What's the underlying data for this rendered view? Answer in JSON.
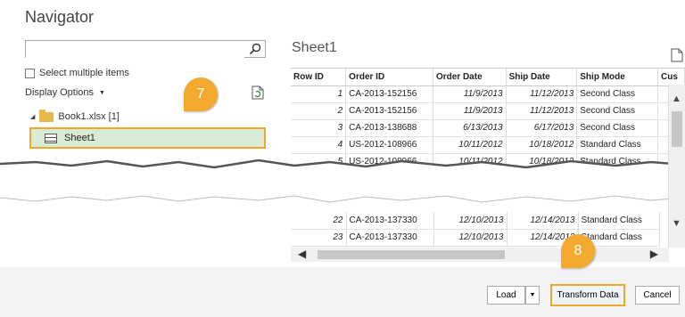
{
  "dialog": {
    "title": "Navigator"
  },
  "left": {
    "search_placeholder": "",
    "select_multiple_label": "Select multiple items",
    "display_options_label": "Display Options",
    "tree": {
      "workbook_label": "Book1.xlsx [1]",
      "sheet_label": "Sheet1"
    }
  },
  "preview": {
    "title": "Sheet1",
    "columns": [
      "Row ID",
      "Order ID",
      "Order Date",
      "Ship Date",
      "Ship Mode",
      "Cus"
    ],
    "rows_top": [
      [
        "1",
        "CA-2013-152156",
        "11/9/2013",
        "11/12/2013",
        "Second Class"
      ],
      [
        "2",
        "CA-2013-152156",
        "11/9/2013",
        "11/12/2013",
        "Second Class"
      ],
      [
        "3",
        "CA-2013-138688",
        "6/13/2013",
        "6/17/2013",
        "Second Class"
      ],
      [
        "4",
        "US-2012-108966",
        "10/11/2012",
        "10/18/2012",
        "Standard Class"
      ],
      [
        "5",
        "US-2012-108966",
        "10/11/2012",
        "10/18/2012",
        "Standard Class"
      ]
    ],
    "rows_bottom": [
      [
        "22",
        "CA-2013-137330",
        "12/10/2013",
        "12/14/2013",
        "Standard Class"
      ],
      [
        "23",
        "CA-2013-137330",
        "12/10/2013",
        "12/14/2013",
        "Standard Class"
      ]
    ]
  },
  "footer": {
    "load_label": "Load",
    "transform_label": "Transform Data",
    "cancel_label": "Cancel"
  },
  "callouts": {
    "step7": "7",
    "step8": "8"
  },
  "colors": {
    "highlight_border": "#f0a72e",
    "selected_bg": "#d7ecd3",
    "badge": "#f2a92e"
  }
}
